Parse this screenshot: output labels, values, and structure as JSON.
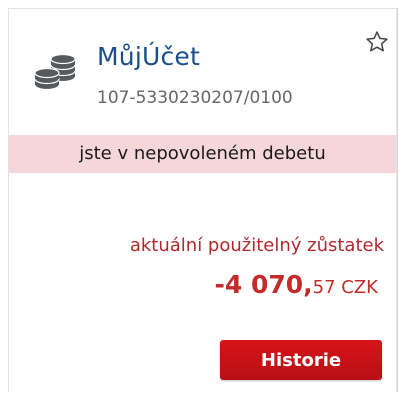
{
  "account": {
    "icon": "coins-stack-icon",
    "name": "MůjÚčet",
    "number": "107-5330230207/0100",
    "favorite_icon": "star-outline-icon"
  },
  "status": {
    "message": "jste v nepovoleném debetu"
  },
  "balance": {
    "label": "aktuální použitelný zůstatek",
    "whole": "-4 070,",
    "decimals": "57",
    "currency": " CZK"
  },
  "actions": {
    "history_label": "Historie"
  },
  "colors": {
    "accent_blue": "#1a4f8c",
    "alert_red": "#c42b2b",
    "banner_bg": "#f5d6d9",
    "button_red": "#d7141a"
  }
}
